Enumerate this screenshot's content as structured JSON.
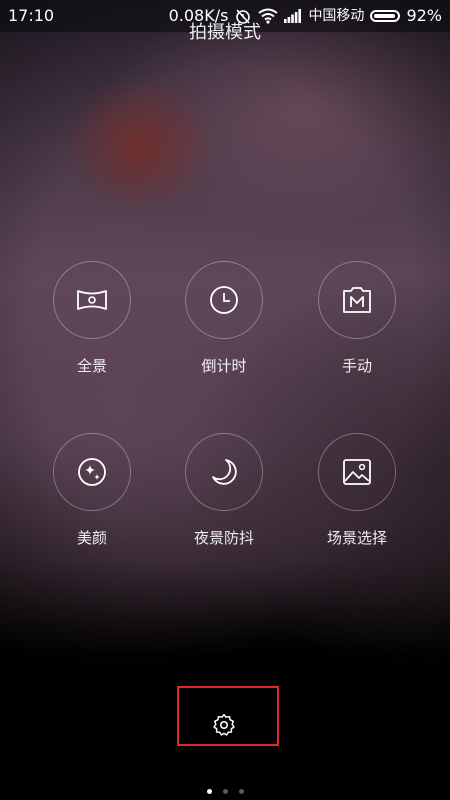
{
  "status_bar": {
    "time": "17:10",
    "net_speed": "0.08K/s",
    "carrier": "中国移动",
    "battery_percent": "92%",
    "battery_level": 0.92
  },
  "title": "拍摄模式",
  "modes": [
    {
      "label": "全景",
      "icon": "panorama-icon"
    },
    {
      "label": "倒计时",
      "icon": "timer-icon"
    },
    {
      "label": "手动",
      "icon": "manual-icon"
    },
    {
      "label": "美颜",
      "icon": "beauty-icon"
    },
    {
      "label": "夜景防抖",
      "icon": "night-moon-icon"
    },
    {
      "label": "场景选择",
      "icon": "scene-image-icon"
    }
  ],
  "settings": {
    "icon": "gear-icon",
    "highlight_color": "#e3252c"
  },
  "pager": {
    "total": 3,
    "active": 1
  }
}
